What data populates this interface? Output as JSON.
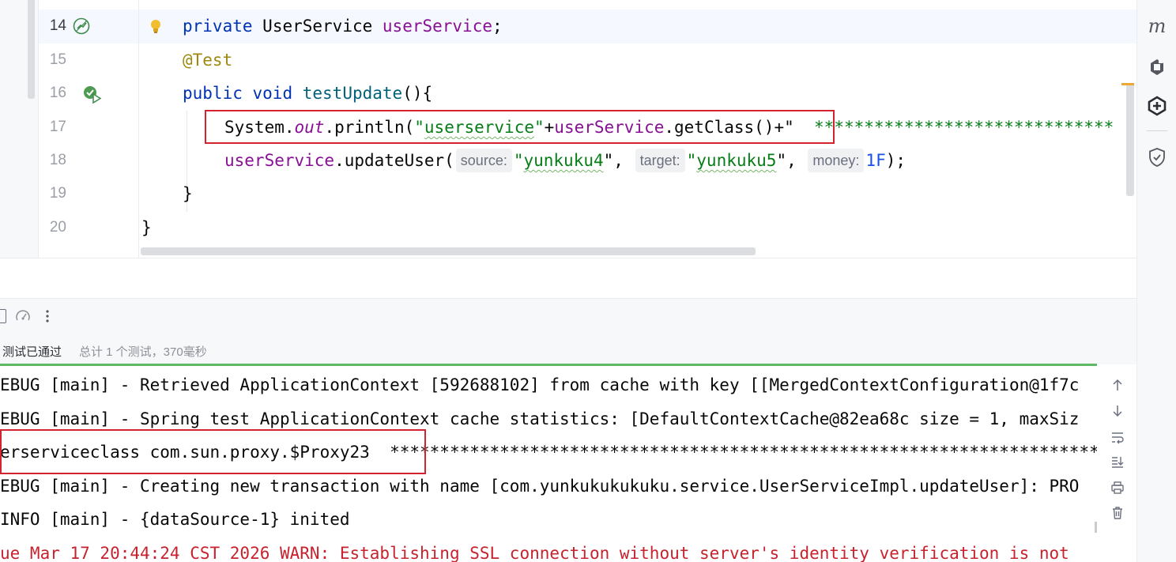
{
  "editor": {
    "lines": [
      {
        "num": "14",
        "tokens": {
          "kw": "private",
          "type": "UserService",
          "field": "userService",
          "end": ";"
        }
      },
      {
        "num": "15",
        "annotation": "@Test"
      },
      {
        "num": "16",
        "tokens": {
          "kw1": "public",
          "kw2": "void",
          "method": "testUpdate",
          "end": "(){"
        }
      },
      {
        "num": "17",
        "tokens": {
          "cls": "System.",
          "static": "out",
          "call": ".println(",
          "q1": "\"",
          "str": "userservice",
          "q2": "\"",
          "plus": "+",
          "field": "userService",
          "rest": ".getClass()+\"",
          "stars": "  ******************************"
        }
      },
      {
        "num": "18",
        "tokens": {
          "field": "userService",
          "call": ".updateUser(",
          "hint1": "source:",
          "arg1q": "\"",
          "arg1": "yunkuku4",
          "arg1e": "\",",
          "hint2": "target:",
          "arg2q": "\"",
          "arg2": "yunkuku5",
          "arg2e": "\",",
          "hint3": "money:",
          "arg3": "1F",
          "end": ");"
        }
      },
      {
        "num": "19",
        "code": "}"
      },
      {
        "num": "20",
        "code": "}"
      }
    ]
  },
  "run_panel": {
    "status": "测试已通过",
    "summary": "总计 1 个测试，370毫秒",
    "console_lines": [
      "EBUG [main] - Retrieved ApplicationContext [592688102] from cache with key [[MergedContextConfiguration@1f7c",
      "EBUG [main] - Spring test ApplicationContext cache statistics: [DefaultContextCache@82ea68c size = 1, maxSiz",
      "erserviceclass com.sun.proxy.$Proxy23  ***********************************************************************",
      "EBUG [main] - Creating new transaction with name [com.yunkukukukuku.service.UserServiceImpl.updateUser]: PRO",
      "INFO [main] - {dataSource-1} inited",
      "ue Mar 17 20:44:24 CST 2026 WARN: Establishing SSL connection without server's identity verification is not"
    ]
  },
  "right_toolbar": {
    "icons": [
      "maven-icon",
      "plugins-icon",
      "ai-assistant-icon",
      "security-shield-icon"
    ],
    "maven_label": "m"
  },
  "colors": {
    "keyword": "#0033b3",
    "field": "#871094",
    "string": "#067d17",
    "annotation": "#9e880d",
    "error": "#c7222d",
    "highlight_box": "#d3232f",
    "progress": "#5fb865"
  }
}
